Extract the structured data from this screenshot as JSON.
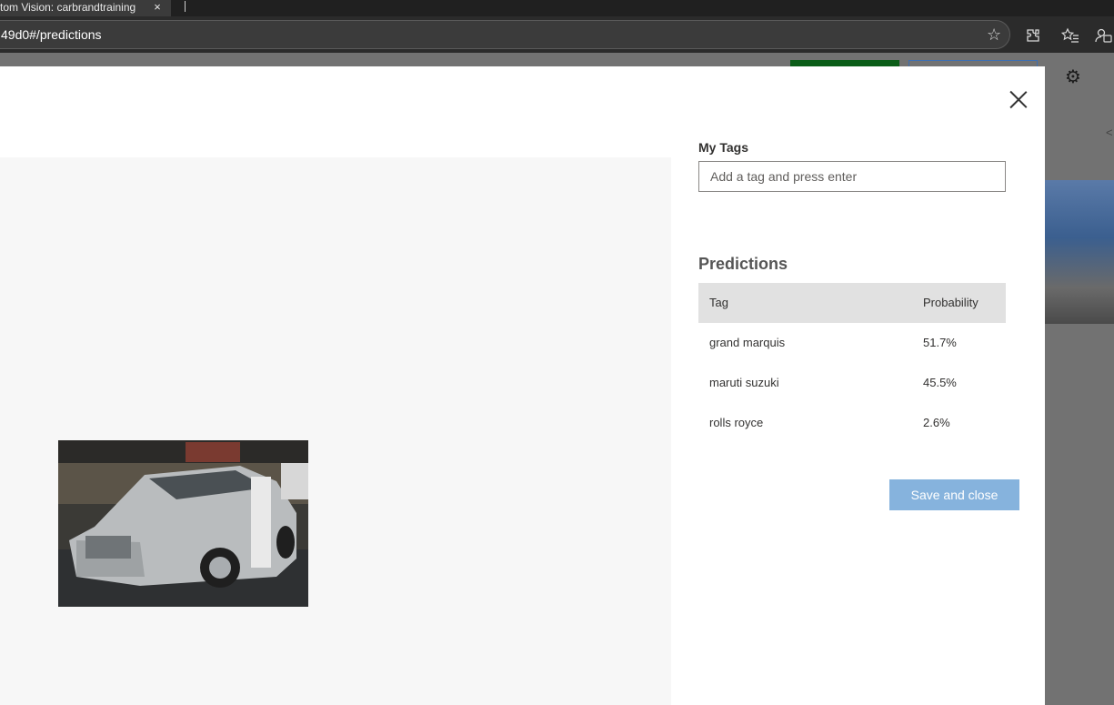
{
  "browser": {
    "tab_title": "tom Vision: carbrandtraining",
    "tab_close": "×",
    "url": "49d0#/predictions",
    "icons": [
      "favorite-star-icon",
      "extensions-icon",
      "favorites-icon",
      "profile-icon"
    ]
  },
  "modal": {
    "my_tags_label": "My Tags",
    "tag_input_placeholder": "Add a tag and press enter",
    "tag_input_value": "",
    "predictions_title": "Predictions",
    "table": {
      "headers": [
        "Tag",
        "Probability"
      ],
      "rows": [
        {
          "tag": "grand marquis",
          "probability": "51.7%"
        },
        {
          "tag": "maruti suzuki",
          "probability": "45.5%"
        },
        {
          "tag": "rolls royce",
          "probability": "2.6%"
        }
      ]
    },
    "save_button": "Save and close"
  },
  "colors": {
    "save_button_bg": "#86b3dd",
    "table_header_bg": "#e1e1e1",
    "background_green_button": "#0b5d18"
  }
}
